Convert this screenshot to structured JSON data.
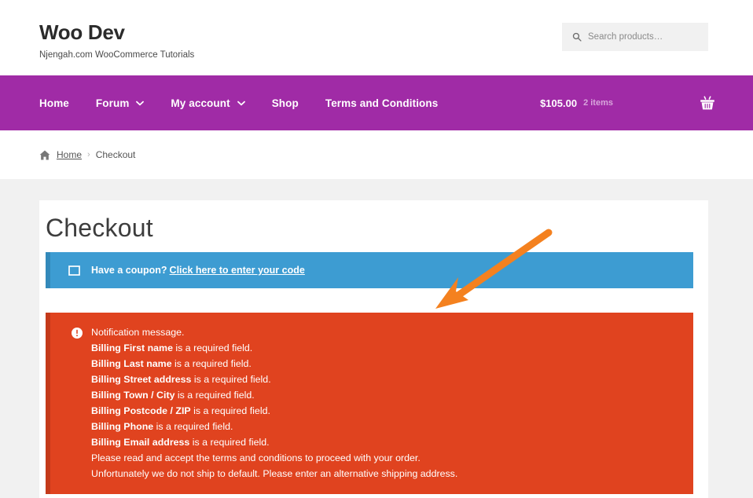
{
  "header": {
    "site_title": "Woo Dev",
    "tagline": "Njengah.com WooCommerce Tutorials",
    "search": {
      "placeholder": "Search products…",
      "value": "",
      "icon": "search-icon"
    }
  },
  "nav": {
    "items": [
      {
        "label": "Home",
        "has_dropdown": false
      },
      {
        "label": "Forum",
        "has_dropdown": true
      },
      {
        "label": "My account",
        "has_dropdown": true
      },
      {
        "label": "Shop",
        "has_dropdown": false
      },
      {
        "label": "Terms and Conditions",
        "has_dropdown": false
      }
    ],
    "cart": {
      "amount": "$105.00",
      "items": "2 items",
      "icon": "shopping-basket-icon"
    },
    "background_color": "#a02ba6"
  },
  "breadcrumb": {
    "home_icon": "home-icon",
    "home_label": "Home",
    "separator": "›",
    "current": "Checkout"
  },
  "main": {
    "page_title": "Checkout",
    "coupon": {
      "icon": "coupon-ticket-icon",
      "text": "Have a coupon?",
      "link_label": "Click here to enter your code",
      "background_color": "#3d9cd2",
      "accent_color": "#3389ba"
    },
    "error_notice": {
      "icon": "exclamation-circle-icon",
      "background_color": "#e0431f",
      "accent_color": "#c43a1a",
      "messages": [
        {
          "bold": "",
          "rest": "Notification message."
        },
        {
          "bold": "Billing First name",
          "rest": " is a required field."
        },
        {
          "bold": "Billing Last name",
          "rest": " is a required field."
        },
        {
          "bold": "Billing Street address",
          "rest": " is a required field."
        },
        {
          "bold": "Billing Town / City",
          "rest": " is a required field."
        },
        {
          "bold": "Billing Postcode / ZIP",
          "rest": " is a required field."
        },
        {
          "bold": "Billing Phone",
          "rest": " is a required field."
        },
        {
          "bold": "Billing Email address",
          "rest": " is a required field."
        },
        {
          "bold": "",
          "rest": "Please read and accept the terms and conditions to proceed with your order."
        },
        {
          "bold": "",
          "rest": "Unfortunately we do not ship to default. Please enter an alternative shipping address."
        }
      ]
    }
  },
  "annotation": {
    "arrow_color": "#f4811f",
    "name": "annotation-arrow"
  }
}
